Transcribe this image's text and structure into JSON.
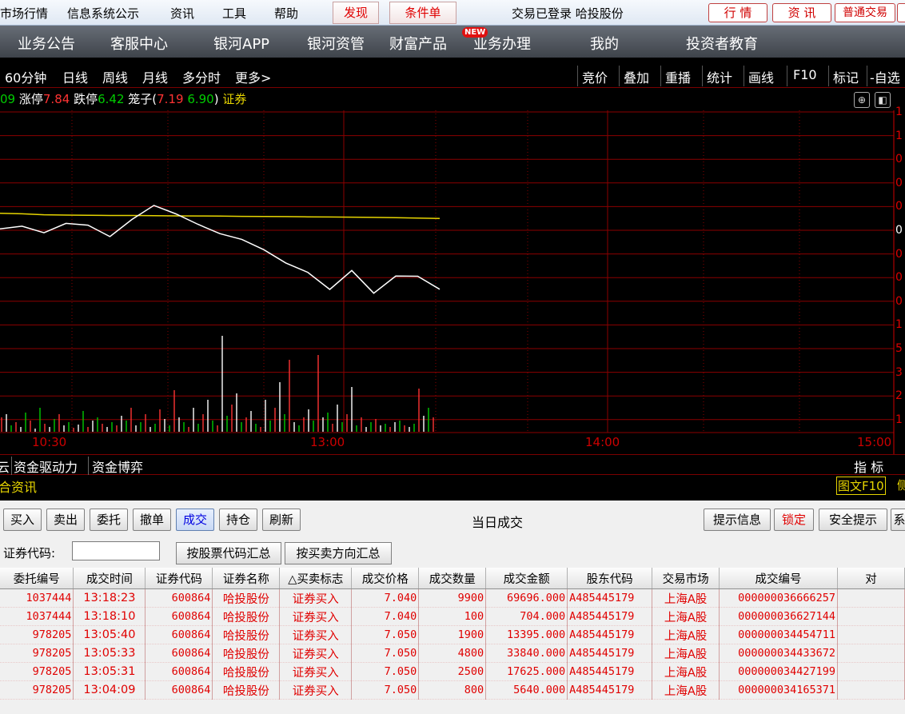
{
  "menu": {
    "items": [
      "市场行情",
      "信息系统公示",
      "资讯",
      "工具",
      "帮助"
    ],
    "tab_discover": "发现",
    "tab_condition": "条件单",
    "login_status": "交易已登录 哈投股份",
    "right_buttons": [
      "行 情",
      "资 讯",
      "普通交易"
    ]
  },
  "nav": {
    "items": [
      "业务公告",
      "客服中心",
      "银河APP",
      "银河资管",
      "财富产品",
      "业务办理",
      "我的",
      "投资者教育"
    ],
    "new_badge": "NEW"
  },
  "periods": [
    "60分钟",
    "日线",
    "周线",
    "月线",
    "多分时",
    "更多>"
  ],
  "chart_tools": [
    "竞价",
    "叠加",
    "重播",
    "统计",
    "画线",
    "F10",
    "标记",
    "-自选"
  ],
  "quote": {
    "prefix": "09",
    "limit_up_label": "涨停",
    "limit_up": "7.84",
    "limit_down_label": "跌停",
    "limit_down": "6.42",
    "cage_label": "笼子(",
    "cage_high": "7.19",
    "cage_low": "6.90",
    "cage_close": ")",
    "sector": "证券"
  },
  "right_axis_labels": [
    "1",
    "1",
    "0",
    "0",
    "0",
    "0",
    "0",
    "0",
    "0",
    "1",
    "5",
    "3",
    "2",
    "1"
  ],
  "chart_data": {
    "type": "line",
    "x_ticks": [
      "10:30",
      "13:00",
      "14:00",
      "15:00"
    ],
    "series": [
      {
        "values": [
          0.62,
          0.56,
          0.46,
          0.42,
          0.4,
          0.38,
          0.38,
          0.36,
          0.34,
          0.33,
          0.31,
          0.29,
          0.28,
          0.26,
          0.24,
          0.22,
          0.2,
          0.18,
          0.14,
          0.1,
          0.06
        ]
      },
      {
        "values": [
          -1.35,
          -0.45,
          -1.75,
          -0.15,
          -0.95,
          -1.55,
          -0.35,
          1.75,
          0.25,
          -0.25,
          -1.85,
          -1.85,
          -3.55,
          -4.35,
          -5.95,
          -7.15,
          -5.75,
          -7.55,
          -6.35,
          -5.75,
          -7.75
        ]
      }
    ],
    "volume_bars": [
      18,
      22,
      8,
      12,
      6,
      24,
      14,
      4,
      30,
      10,
      6,
      16,
      22,
      8,
      12,
      5,
      9,
      26,
      6,
      14,
      18,
      10,
      6,
      12,
      8,
      20,
      14,
      30,
      8,
      12,
      22,
      6,
      10,
      28,
      16,
      8,
      52,
      18,
      12,
      6,
      30,
      10,
      22,
      40,
      14,
      8,
      120,
      20,
      34,
      48,
      12,
      18,
      26,
      10,
      6,
      40,
      14,
      30,
      62,
      22,
      90,
      12,
      8,
      18,
      28,
      14,
      96,
      18,
      24,
      10,
      34,
      12,
      22,
      56,
      8,
      18,
      6,
      12,
      16,
      8,
      10,
      6,
      12,
      14,
      8,
      6,
      10,
      54,
      20,
      30,
      18
    ]
  },
  "bottom_tabs": [
    "云",
    "资金驱动力",
    "资金博弈"
  ],
  "indicator_label": "指 标",
  "zixun_label": "合资讯",
  "tuwen_label": "图文F10",
  "tuwen_suffix": "侧",
  "trade": {
    "buttons": [
      "买入",
      "卖出",
      "委托",
      "撤单",
      "成交",
      "持仓",
      "刷新"
    ],
    "active_button": "成交",
    "title": "当日成交",
    "right_buttons": [
      "提示信息",
      "锁定",
      "安全提示",
      "系"
    ],
    "code_label": "证券代码:",
    "code_value": "",
    "group_buttons": [
      "按股票代码汇总",
      "按买卖方向汇总"
    ],
    "columns": [
      "委托编号",
      "成交时间",
      "证券代码",
      "证券名称",
      "△买卖标志",
      "成交价格",
      "成交数量",
      "成交金额",
      "股东代码",
      "交易市场",
      "成交编号",
      "对"
    ],
    "rows": [
      [
        "1037444",
        "13:18:23",
        "600864",
        "哈投股份",
        "证券买入",
        "7.040",
        "9900",
        "69696.000",
        "A485445179",
        "上海A股",
        "000000036666257",
        ""
      ],
      [
        "1037444",
        "13:18:10",
        "600864",
        "哈投股份",
        "证券买入",
        "7.040",
        "100",
        "704.000",
        "A485445179",
        "上海A股",
        "000000036627144",
        ""
      ],
      [
        "978205",
        "13:05:40",
        "600864",
        "哈投股份",
        "证券买入",
        "7.050",
        "1900",
        "13395.000",
        "A485445179",
        "上海A股",
        "000000034454711",
        ""
      ],
      [
        "978205",
        "13:05:33",
        "600864",
        "哈投股份",
        "证券买入",
        "7.050",
        "4800",
        "33840.000",
        "A485445179",
        "上海A股",
        "000000034433672",
        ""
      ],
      [
        "978205",
        "13:05:31",
        "600864",
        "哈投股份",
        "证券买入",
        "7.050",
        "2500",
        "17625.000",
        "A485445179",
        "上海A股",
        "000000034427199",
        ""
      ],
      [
        "978205",
        "13:04:09",
        "600864",
        "哈投股份",
        "证券买入",
        "7.050",
        "800",
        "5640.000",
        "A485445179",
        "上海A股",
        "000000034165371",
        ""
      ]
    ]
  },
  "colors": {
    "grid": "#8b0000",
    "price_line": "#ffffff",
    "avg_line": "#e6d400",
    "up": "#ff3333",
    "down": "#00cc00",
    "time_label": "#cc0000",
    "active_button": "#0000e0"
  }
}
